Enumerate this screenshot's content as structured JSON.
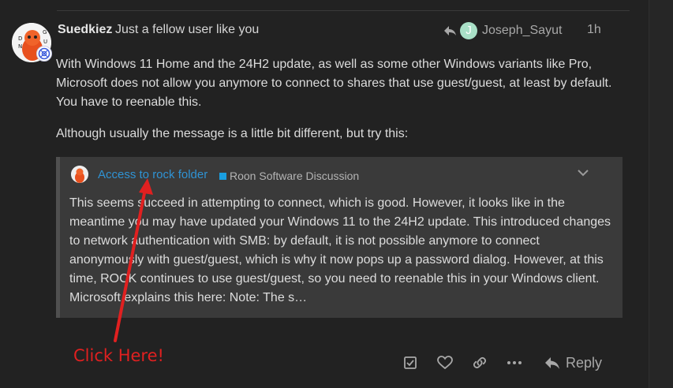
{
  "post": {
    "username": "Suedkiez",
    "user_title": "Just a fellow user like you",
    "reply_to": {
      "initial": "J",
      "name": "Joseph_Sayut"
    },
    "age": "1h",
    "paragraphs": [
      "With Windows 11 Home and the 24H2 update, as well as some other Windows variants like Pro, Microsoft does not allow you anymore to connect to shares that use guest/guest, at least by default. You have to reenable this.",
      "Although usually the message is a little bit different, but try this:"
    ]
  },
  "quote": {
    "title": "Access to rock folder",
    "category": "Roon Software Discussion",
    "category_color": "#1a9ee0",
    "excerpt": "This seems succeed in attempting to connect, which is good. However, it looks like in the meantime you may have updated your Windows 11 to the 24H2 update. This introduced changes to network authentication with SMB: by default, it is not possible anymore to connect anonymously with guest/guest, which is why it now pops up a password dialog. However, at this time, ROCK continues to use guest/guest, so you need to reenable this in your Windows client. Microsoft explains this here: Note: The s…"
  },
  "annotation": {
    "text": "Click Here!",
    "color": "#e02020"
  },
  "actions": {
    "icons": [
      "solution-checkbox-icon",
      "heart-icon",
      "link-icon",
      "more-dots-icon"
    ],
    "reply_label": "Reply"
  },
  "colors": {
    "background": "#222222",
    "quote_bg": "#3a3a3a",
    "link": "#2f93d4"
  }
}
